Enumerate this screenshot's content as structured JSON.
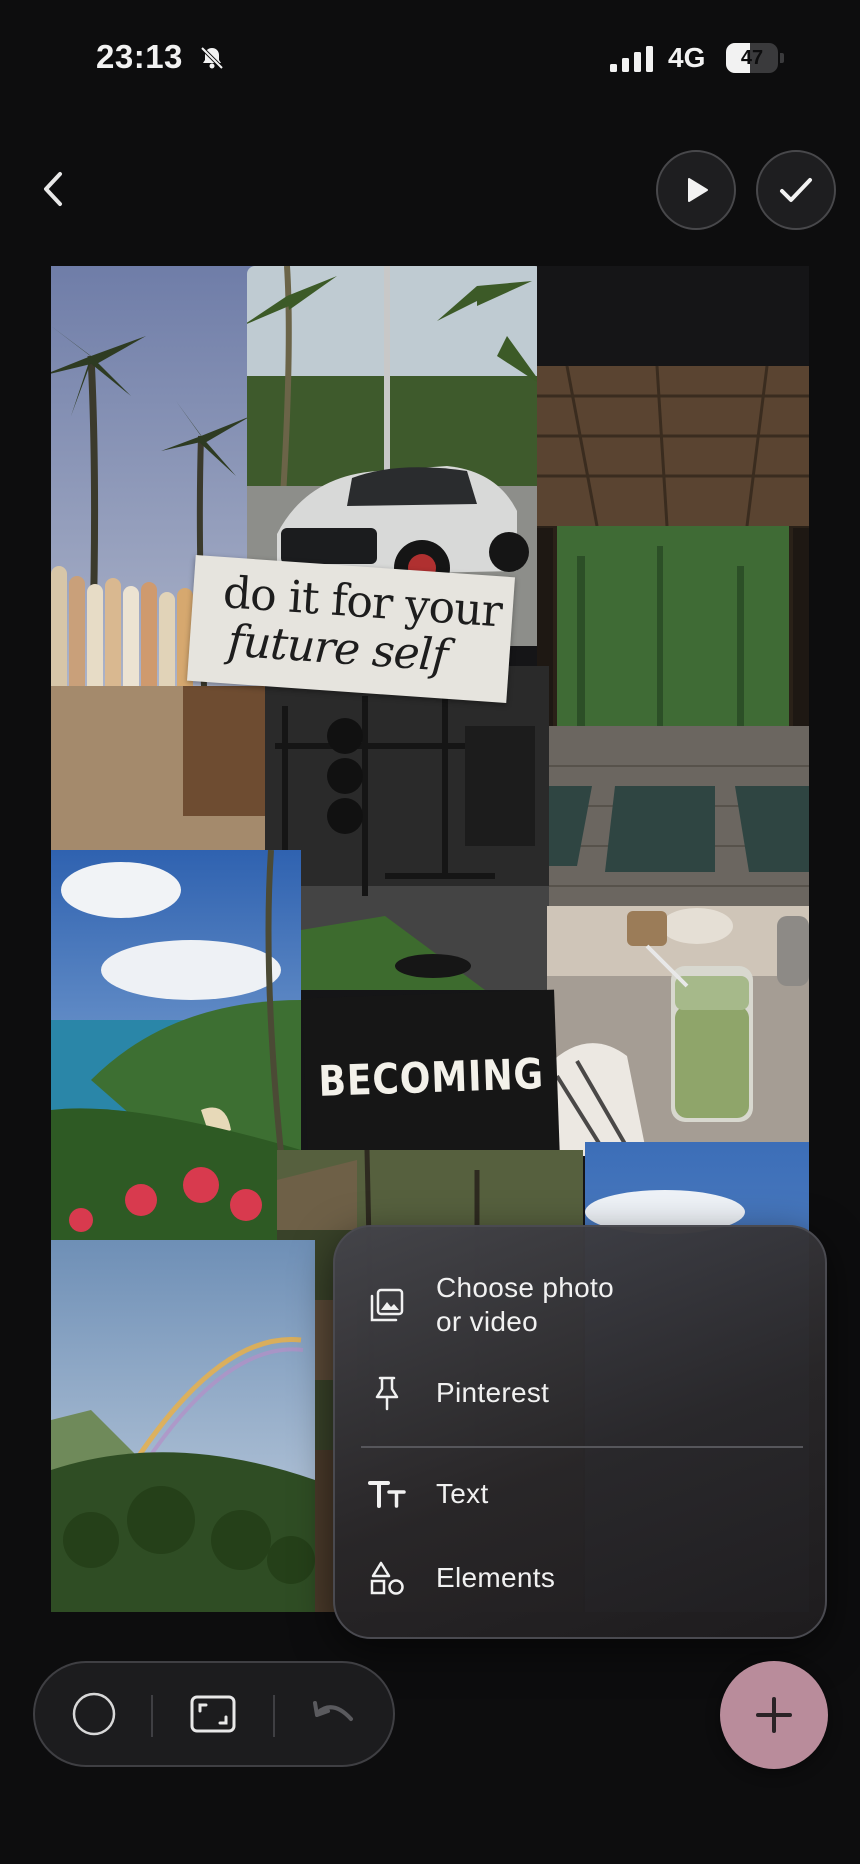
{
  "status_bar": {
    "time": "23:13",
    "network": "4G",
    "battery_level": "47",
    "battery_fraction": 0.47,
    "icons": [
      "bell-off-icon",
      "cellular-signal-icon",
      "battery-icon"
    ]
  },
  "header": {
    "icons": [
      "chevron-left-icon",
      "play-icon",
      "checkmark-icon"
    ]
  },
  "collage": {
    "quote_line1": "do it for your",
    "quote_line2": "future self",
    "caption": "BECOMING",
    "photos": [
      "palm-trees-surfboards",
      "silver-porsche-suv",
      "thatched-yoga-pavilion",
      "gym-equipment",
      "iced-matcha-latte",
      "tropical-coastline",
      "jungle-terrace",
      "blue-sky",
      "rainbow-mountains"
    ]
  },
  "add_menu": {
    "items": [
      {
        "label_line1": "Choose photo",
        "label_line2": "or video",
        "icon": "photo-library-icon"
      },
      {
        "label": "Pinterest",
        "icon": "pushpin-icon"
      },
      {
        "label": "Text",
        "icon": "text-size-icon"
      },
      {
        "label": "Elements",
        "icon": "shapes-icon"
      }
    ]
  },
  "toolbar": {
    "icons": [
      "circle-shape-icon",
      "aspect-ratio-icon",
      "undo-icon",
      "plus-icon"
    ]
  },
  "colors": {
    "background": "#0d0d0e",
    "accent_add_button": "#b98c9b",
    "menu_surface": "#2e2d31"
  }
}
